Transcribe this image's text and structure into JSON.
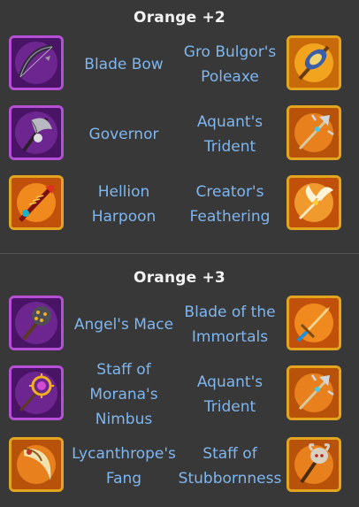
{
  "sections": [
    {
      "title": "Orange +2",
      "rows": [
        {
          "left": {
            "name": "Blade Bow",
            "icon": "blade-bow-icon",
            "frame": "purple"
          },
          "right": {
            "name": "Gro Bulgor's Poleaxe",
            "icon": "poleaxe-icon",
            "frame": "gold"
          }
        },
        {
          "left": {
            "name": "Governor",
            "icon": "governor-axe-icon",
            "frame": "purple"
          },
          "right": {
            "name": "Aquant's Trident",
            "icon": "trident-icon",
            "frame": "gold"
          }
        },
        {
          "left": {
            "name": "Hellion Harpoon",
            "icon": "harpoon-icon",
            "frame": "gold"
          },
          "right": {
            "name": "Creator's Feathering",
            "icon": "feathering-icon",
            "frame": "gold"
          }
        }
      ]
    },
    {
      "title": "Orange +3",
      "rows": [
        {
          "left": {
            "name": "Angel's Mace",
            "icon": "mace-icon",
            "frame": "purple"
          },
          "right": {
            "name": "Blade of the Immortals",
            "icon": "sword-icon",
            "frame": "gold"
          }
        },
        {
          "left": {
            "name": "Staff of Morana's Nimbus",
            "icon": "nimbus-staff-icon",
            "frame": "purple"
          },
          "right": {
            "name": "Aquant's Trident",
            "icon": "trident-icon",
            "frame": "gold"
          }
        },
        {
          "left": {
            "name": "Lycanthrope's Fang",
            "icon": "fang-icon",
            "frame": "gold"
          },
          "right": {
            "name": "Staff of Stubbornness",
            "icon": "stubborn-staff-icon",
            "frame": "gold"
          }
        }
      ]
    }
  ],
  "colors": {
    "background": "#383838",
    "title": "#f2f2f2",
    "label": "#7fb6ef",
    "purple_frame": "#b44fd6",
    "gold_frame": "#e3a51e"
  }
}
